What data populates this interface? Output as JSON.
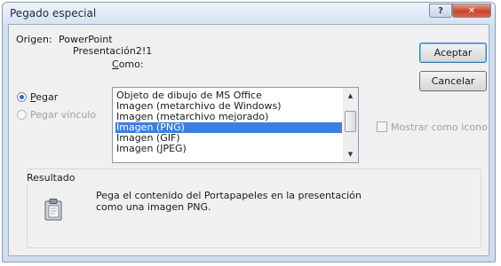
{
  "window": {
    "title": "Pegado especial",
    "close_label": "✕",
    "help_label": "?"
  },
  "source": {
    "label": "Origen:",
    "line1": "PowerPoint",
    "line2": "Presentación2!1"
  },
  "as_label": "Como:",
  "options": {
    "paste": "Pegar",
    "paste_link": "Pegar vínculo"
  },
  "list": {
    "items": [
      "Objeto de dibujo de MS Office",
      "Imagen (metarchivo de Windows)",
      "Imagen (metarchivo mejorado)",
      "Imagen (PNG)",
      "Imagen (GIF)",
      "Imagen (JPEG)"
    ],
    "selected_index": 3
  },
  "buttons": {
    "ok": "Aceptar",
    "cancel": "Cancelar"
  },
  "show_as_icon_label": "Mostrar como icono",
  "result": {
    "label": "Resultado",
    "text_line1": "Pega el contenido del Portapapeles en la presentación",
    "text_line2": "como una imagen PNG."
  }
}
